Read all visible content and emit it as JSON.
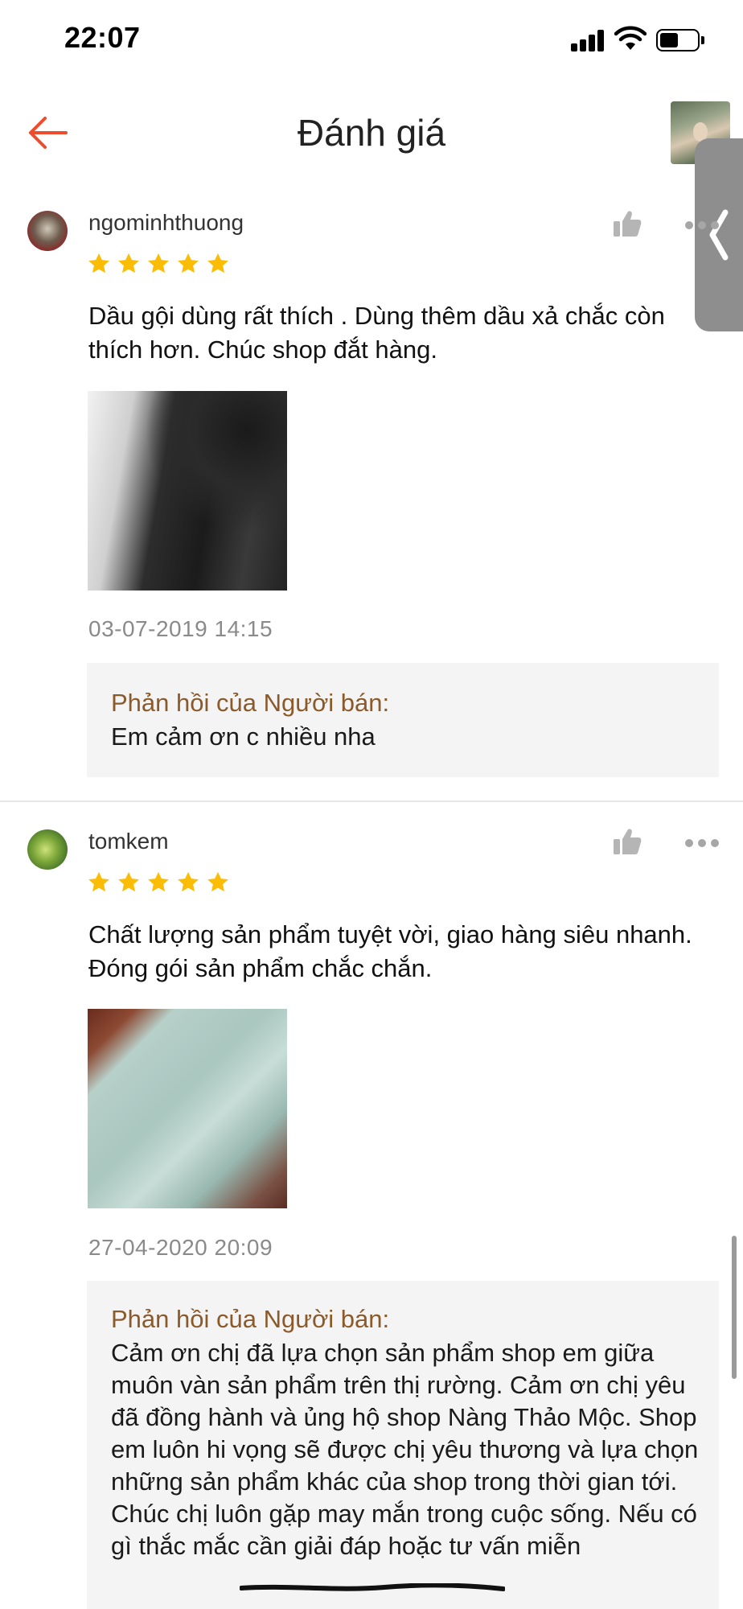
{
  "status_bar": {
    "time": "22:07",
    "icons": [
      "signal-icon",
      "wifi-icon",
      "battery-icon"
    ]
  },
  "header": {
    "title": "Đánh giá",
    "back_icon": "arrow-left-icon",
    "accent_color": "#ee4d2d"
  },
  "side_tab": {
    "icon": "chevron-left-icon"
  },
  "reviews": [
    {
      "username": "ngominhthuong",
      "rating": 5,
      "text": "Dầu gội dùng rất thích . Dùng thêm dầu xả chắc còn thích hơn. Chúc shop đắt hàng.",
      "date": "03-07-2019 14:15",
      "seller_reply": {
        "label": "Phản hồi của Người bán:",
        "text": "Em cảm ơn c nhiều nha"
      }
    },
    {
      "username": "tomkem",
      "rating": 5,
      "text": "Chất lượng sản phẩm tuyệt vời, giao hàng siêu nhanh. Đóng gói sản phẩm chắc chắn.",
      "date": "27-04-2020 20:09",
      "seller_reply": {
        "label": "Phản hồi của Người bán:",
        "text": "Cảm ơn chị đã lựa chọn sản phẩm shop em giữa muôn vàn sản phẩm trên thị rường. Cảm ơn chị yêu đã đồng hành và ủng hộ shop Nàng Thảo Mộc. Shop em luôn hi vọng sẽ được chị yêu thương và lựa chọn những sản phẩm khác của shop trong thời gian tới. Chúc chị luôn gặp may mắn trong cuộc sống. Nếu có gì thắc mắc cần giải đáp hoặc tư vấn miễn"
      }
    }
  ],
  "colors": {
    "star": "#fbbc05",
    "reply_label": "#8a5a2b",
    "reply_bg": "#f4f4f4",
    "date": "#8a8a8a"
  }
}
